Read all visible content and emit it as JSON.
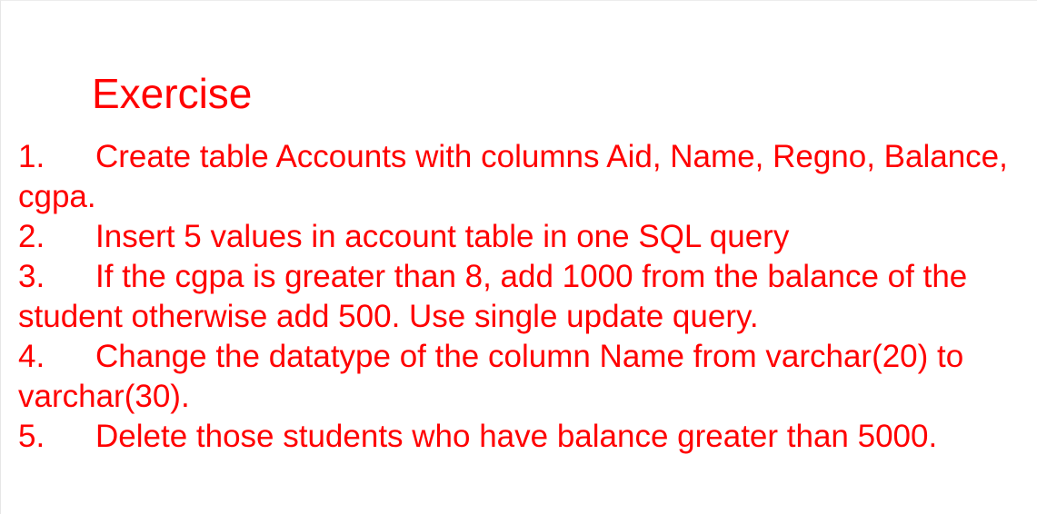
{
  "slide": {
    "title": "Exercise",
    "text_color": "#ff0000",
    "items": [
      {
        "number": "1.",
        "text": "Create table Accounts with columns Aid, Name, Regno, Balance, cgpa."
      },
      {
        "number": "2.",
        "text": "Insert 5 values in account table in one SQL query"
      },
      {
        "number": "3.",
        "text": "If the cgpa is greater than 8, add 1000 from the balance of the student otherwise add 500. Use single update query."
      },
      {
        "number": "4.",
        "text": "Change the datatype of the column Name from varchar(20) to varchar(30)."
      },
      {
        "number": "5.",
        "text": "Delete those students who have balance greater than 5000."
      }
    ]
  }
}
